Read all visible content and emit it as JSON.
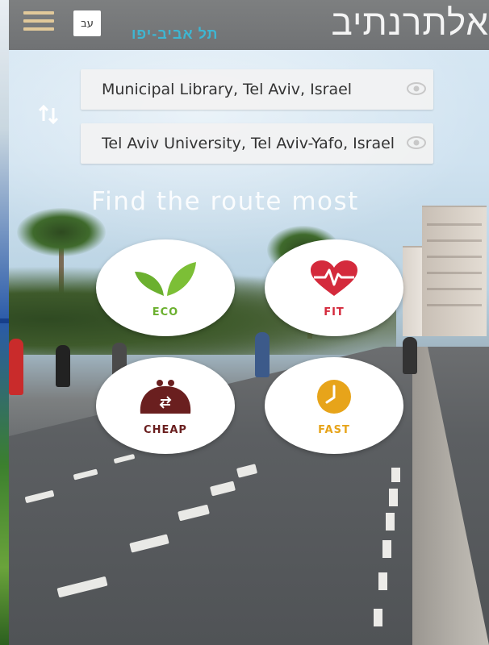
{
  "header": {
    "app_name": "אלתרנתיב",
    "subtitle": "תל אביב-יפו",
    "language_button": "עב"
  },
  "route": {
    "origin": "Municipal Library, Tel Aviv, Israel",
    "destination": "Tel Aviv University, Tel Aviv-Yafo, Israel"
  },
  "tagline": "Find the route most",
  "modes": [
    {
      "label": "ECO",
      "color": "#6bb02f",
      "icon": "leaf-icon"
    },
    {
      "label": "FIT",
      "color": "#d42a3c",
      "icon": "heart-pulse-icon"
    },
    {
      "label": "CHEAP",
      "color": "#6a1f1f",
      "icon": "wallet-icon"
    },
    {
      "label": "FAST",
      "color": "#e7a41a",
      "icon": "clock-icon"
    }
  ]
}
